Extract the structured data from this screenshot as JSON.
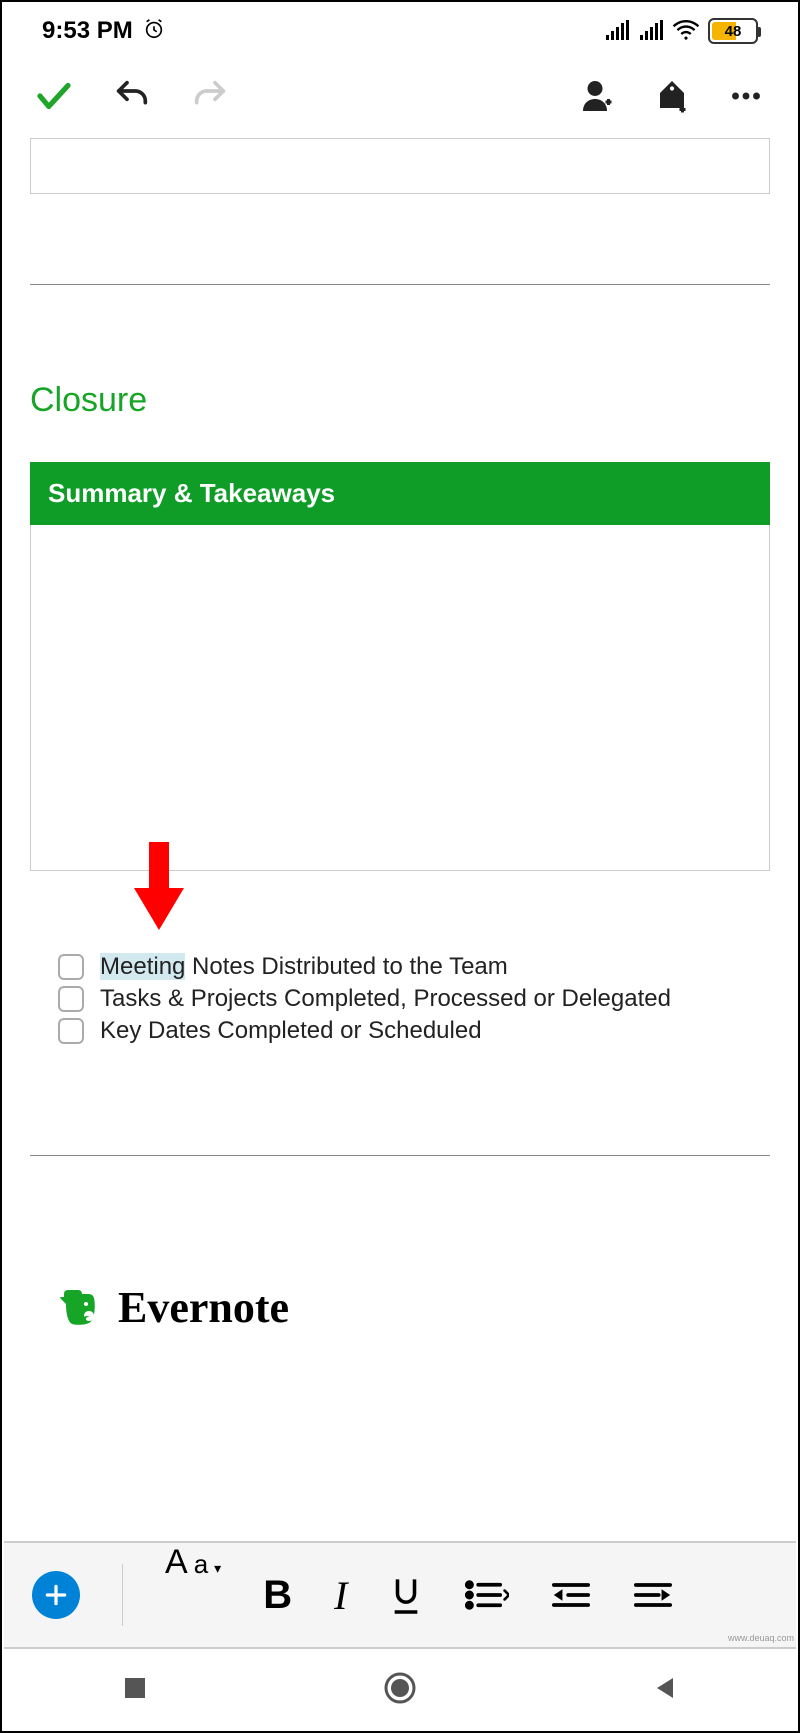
{
  "statusbar": {
    "time": "9:53 PM",
    "battery": "48"
  },
  "section": {
    "title": "Closure",
    "header": "Summary & Takeaways"
  },
  "checks": [
    {
      "hl": "Meeting",
      "rest": " Notes Distributed to the Team"
    },
    {
      "text": "Tasks & Projects Completed, Processed or Delegated"
    },
    {
      "text": "Key Dates Completed or Scheduled"
    }
  ],
  "brand": "Evernote",
  "watermark": "www.deuaq.com"
}
